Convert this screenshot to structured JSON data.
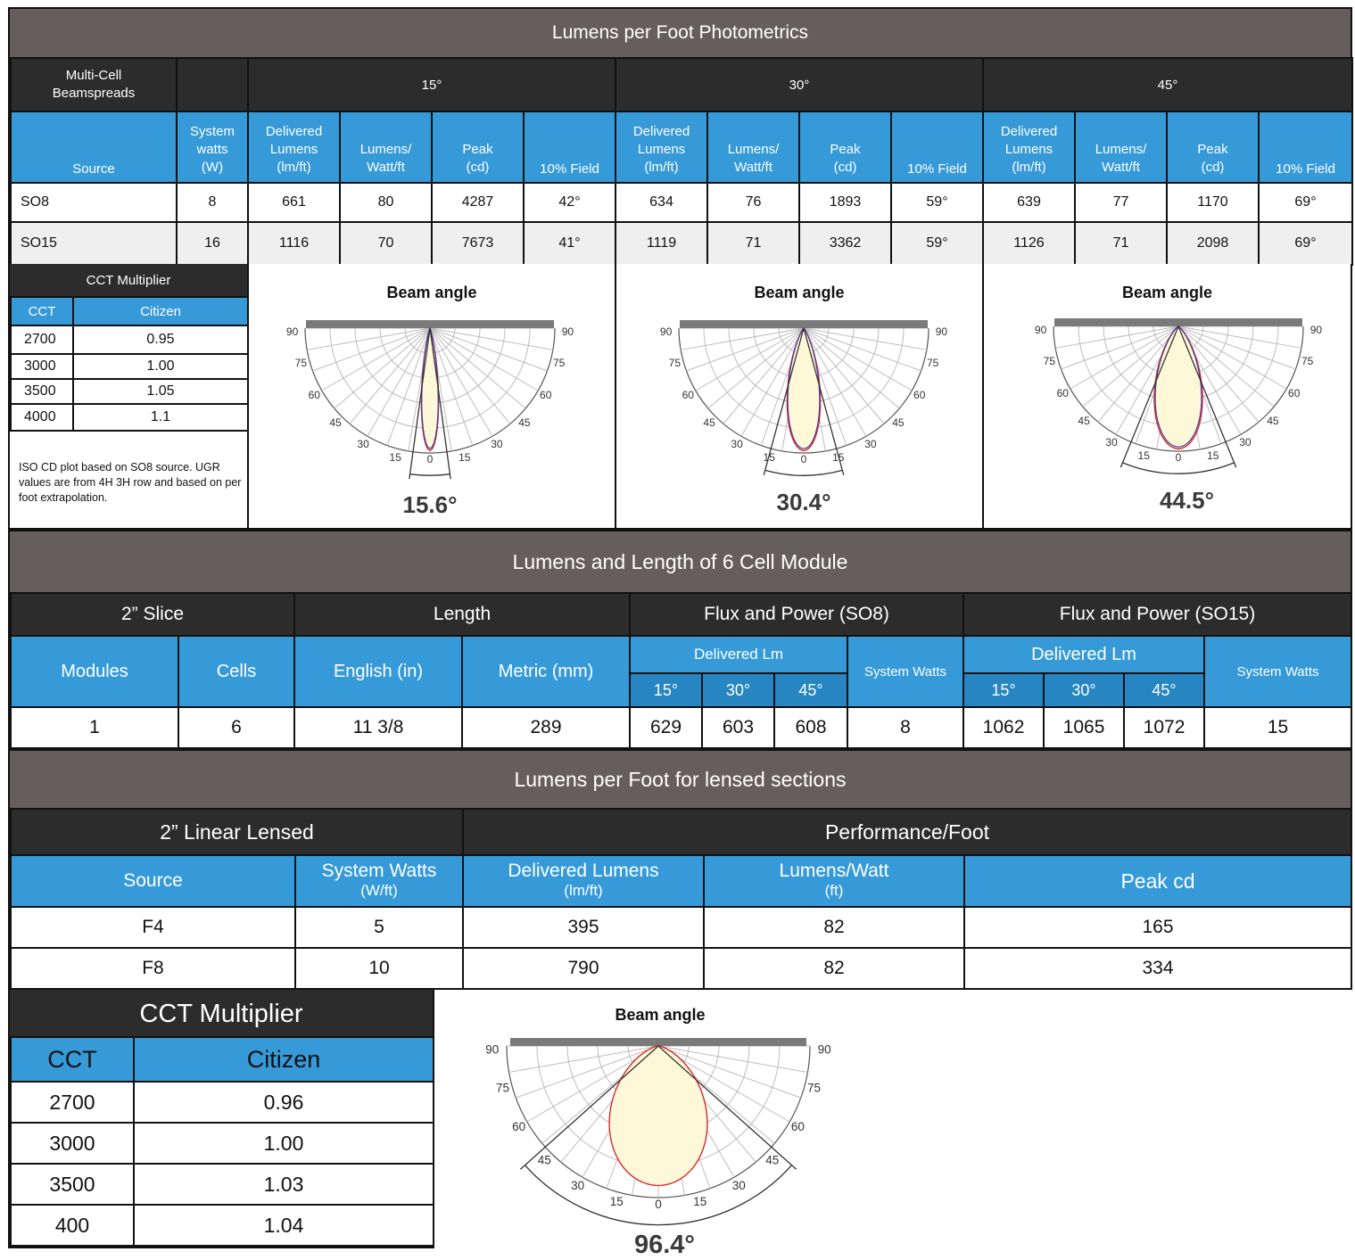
{
  "section1": {
    "title": "Lumens per Foot Photometrics",
    "multi_cell_label": "Multi-Cell Beamspreads",
    "beam_groups": [
      "15°",
      "30°",
      "45°"
    ],
    "headers": {
      "source": "Source",
      "system_watts": "System watts (W)",
      "delivered": "Delivered Lumens (lm/ft)",
      "lumens_watt": "Lumens/ Watt/ft",
      "peak": "Peak (cd)",
      "field": "10% Field"
    },
    "rows": [
      {
        "source": "SO8",
        "watts": "8",
        "values": [
          "661",
          "80",
          "4287",
          "42°",
          "634",
          "76",
          "1893",
          "59°",
          "639",
          "77",
          "1170",
          "69°"
        ]
      },
      {
        "source": "SO15",
        "watts": "16",
        "values": [
          "1116",
          "70",
          "7673",
          "41°",
          "1119",
          "71",
          "3362",
          "59°",
          "1126",
          "71",
          "2098",
          "69°"
        ]
      }
    ],
    "cct": {
      "title": "CCT Multiplier",
      "col1": "CCT",
      "col2": "Citizen",
      "rows": [
        [
          "2700",
          "0.95"
        ],
        [
          "3000",
          "1.00"
        ],
        [
          "3500",
          "1.05"
        ],
        [
          "4000",
          "1.1"
        ]
      ],
      "note": "ISO CD plot based on SO8 source. UGR values are from 4H 3H row and based on per foot extrapolation."
    },
    "plots": [
      {
        "title": "Beam angle",
        "angle": "15.6°",
        "beam": 15.6
      },
      {
        "title": "Beam angle",
        "angle": "30.4°",
        "beam": 30.4
      },
      {
        "title": "Beam angle",
        "angle": "44.5°",
        "beam": 44.5
      }
    ]
  },
  "section2": {
    "title": "Lumens and Length of 6 Cell Module",
    "groups": [
      "2” Slice",
      "Length",
      "Flux and Power (SO8)",
      "Flux and Power (SO15)"
    ],
    "headers": {
      "modules": "Modules",
      "cells": "Cells",
      "english": "English (in)",
      "metric": "Metric (mm)",
      "delivered_lm": "Delivered Lm",
      "system_watts": "System Watts",
      "angles": [
        "15°",
        "30°",
        "45°"
      ]
    },
    "row": {
      "modules": "1",
      "cells": "6",
      "english": "11 3/8",
      "metric": "289",
      "so8": [
        "629",
        "603",
        "608",
        "8"
      ],
      "so15": [
        "1062",
        "1065",
        "1072",
        "15"
      ]
    }
  },
  "section3": {
    "title": "Lumens per Foot for lensed sections",
    "groups": [
      "2” Linear Lensed",
      "Performance/Foot"
    ],
    "headers": {
      "source": "Source",
      "system_watts": "System Watts",
      "system_watts_unit": "(W/ft)",
      "delivered": "Delivered Lumens",
      "delivered_unit": "(lm/ft)",
      "lumens_watt": "Lumens/Watt",
      "lumens_watt_unit": "(ft)",
      "peak": "Peak cd"
    },
    "rows": [
      [
        "F4",
        "5",
        "395",
        "82",
        "165"
      ],
      [
        "F8",
        "10",
        "790",
        "82",
        "334"
      ]
    ]
  },
  "section4": {
    "cct": {
      "title": "CCT Multiplier",
      "col1": "CCT",
      "col2": "Citizen",
      "rows": [
        [
          "2700",
          "0.96"
        ],
        [
          "3000",
          "1.00"
        ],
        [
          "3500",
          "1.03"
        ],
        [
          "400",
          "1.04"
        ]
      ]
    },
    "plot": {
      "title": "Beam angle",
      "angle": "96.4°",
      "beam": 96.4
    }
  },
  "polar_labels": {
    "left": [
      "90",
      "75",
      "60",
      "45",
      "30",
      "15"
    ],
    "center": "0",
    "right": [
      "15",
      "30",
      "45",
      "60",
      "75",
      "90"
    ]
  }
}
